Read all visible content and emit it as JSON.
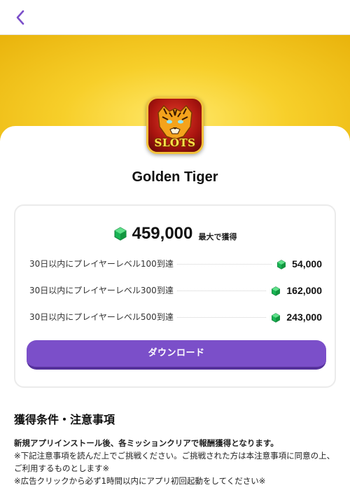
{
  "header": {
    "back_icon": "chevron-left-icon",
    "accent_color": "#7b4fc9"
  },
  "app": {
    "name": "Golden Tiger",
    "icon_text": "SLOTS",
    "icon_name": "golden-tiger-slots-icon"
  },
  "reward": {
    "total": "459,000",
    "total_suffix": "最大で獲得",
    "gem_icon": "green-gem-icon",
    "missions": [
      {
        "label": "30日以内にプレイヤーレベル100到達",
        "value": "54,000"
      },
      {
        "label": "30日以内にプレイヤーレベル300到達",
        "value": "162,000"
      },
      {
        "label": "30日以内にプレイヤーレベル500到達",
        "value": "243,000"
      }
    ],
    "download_label": "ダウンロード"
  },
  "conditions": {
    "title": "獲得条件・注意事項",
    "lines": [
      "新規アプリインストール後、各ミッションクリアで報酬獲得となります。",
      "※下記注意事項を読んだ上でご挑戦ください。ご挑戦された方は本注意事項に同意の上、ご利用するものとします※",
      "※広告クリックから必ず1時間以内にアプリ初回起動をしてください※"
    ]
  }
}
